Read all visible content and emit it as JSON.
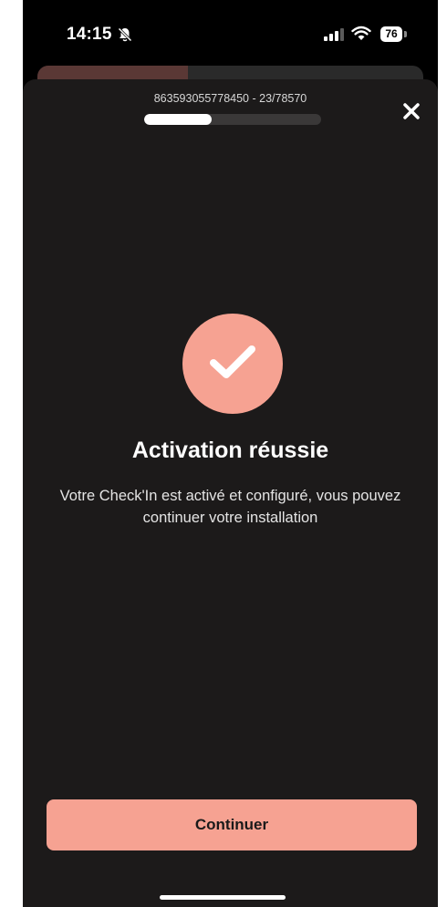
{
  "status_bar": {
    "time": "14:15",
    "battery": "76",
    "icons": [
      "bell-slash-icon",
      "signal-icon",
      "wifi-icon",
      "battery-icon"
    ]
  },
  "header": {
    "serial": "863593055778450 - 23/78570",
    "progress": 0.38,
    "close_icon": "close-icon"
  },
  "main": {
    "icon": "check-icon",
    "title": "Activation réussie",
    "description": "Votre Check'In est activé et configuré, vous pouvez continuer votre installation"
  },
  "footer": {
    "continue_label": "Continuer"
  },
  "colors": {
    "accent": "#f6a292",
    "sheet_background": "#1c1a1a",
    "screen_background": "#000000"
  }
}
